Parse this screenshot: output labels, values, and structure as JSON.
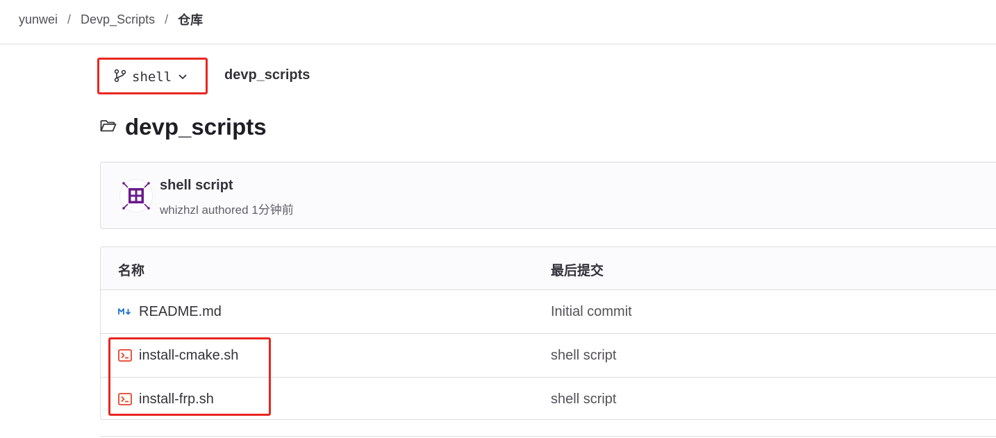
{
  "breadcrumb": {
    "items": [
      "yunwei",
      "Devp_Scripts",
      "仓库"
    ],
    "separator": "/"
  },
  "branch": {
    "name": "shell",
    "icon": "branch-icon"
  },
  "repo_path": "devp_scripts",
  "title": "devp_scripts",
  "last_commit": {
    "message": "shell script",
    "meta": "whizhzl authored 1分钟前",
    "avatar_color": "#6a1b8a"
  },
  "table": {
    "headers": [
      "名称",
      "最后提交"
    ],
    "rows": [
      {
        "name": "README.md",
        "icon": "markdown-icon",
        "commit": "Initial commit"
      },
      {
        "name": "install-cmake.sh",
        "icon": "shell-file-icon",
        "commit": "shell script"
      },
      {
        "name": "install-frp.sh",
        "icon": "shell-file-icon",
        "commit": "shell script"
      }
    ]
  },
  "colors": {
    "highlight": "#e8261f",
    "markdown_icon": "#1f75cb",
    "shell_icon": "#e24329"
  }
}
